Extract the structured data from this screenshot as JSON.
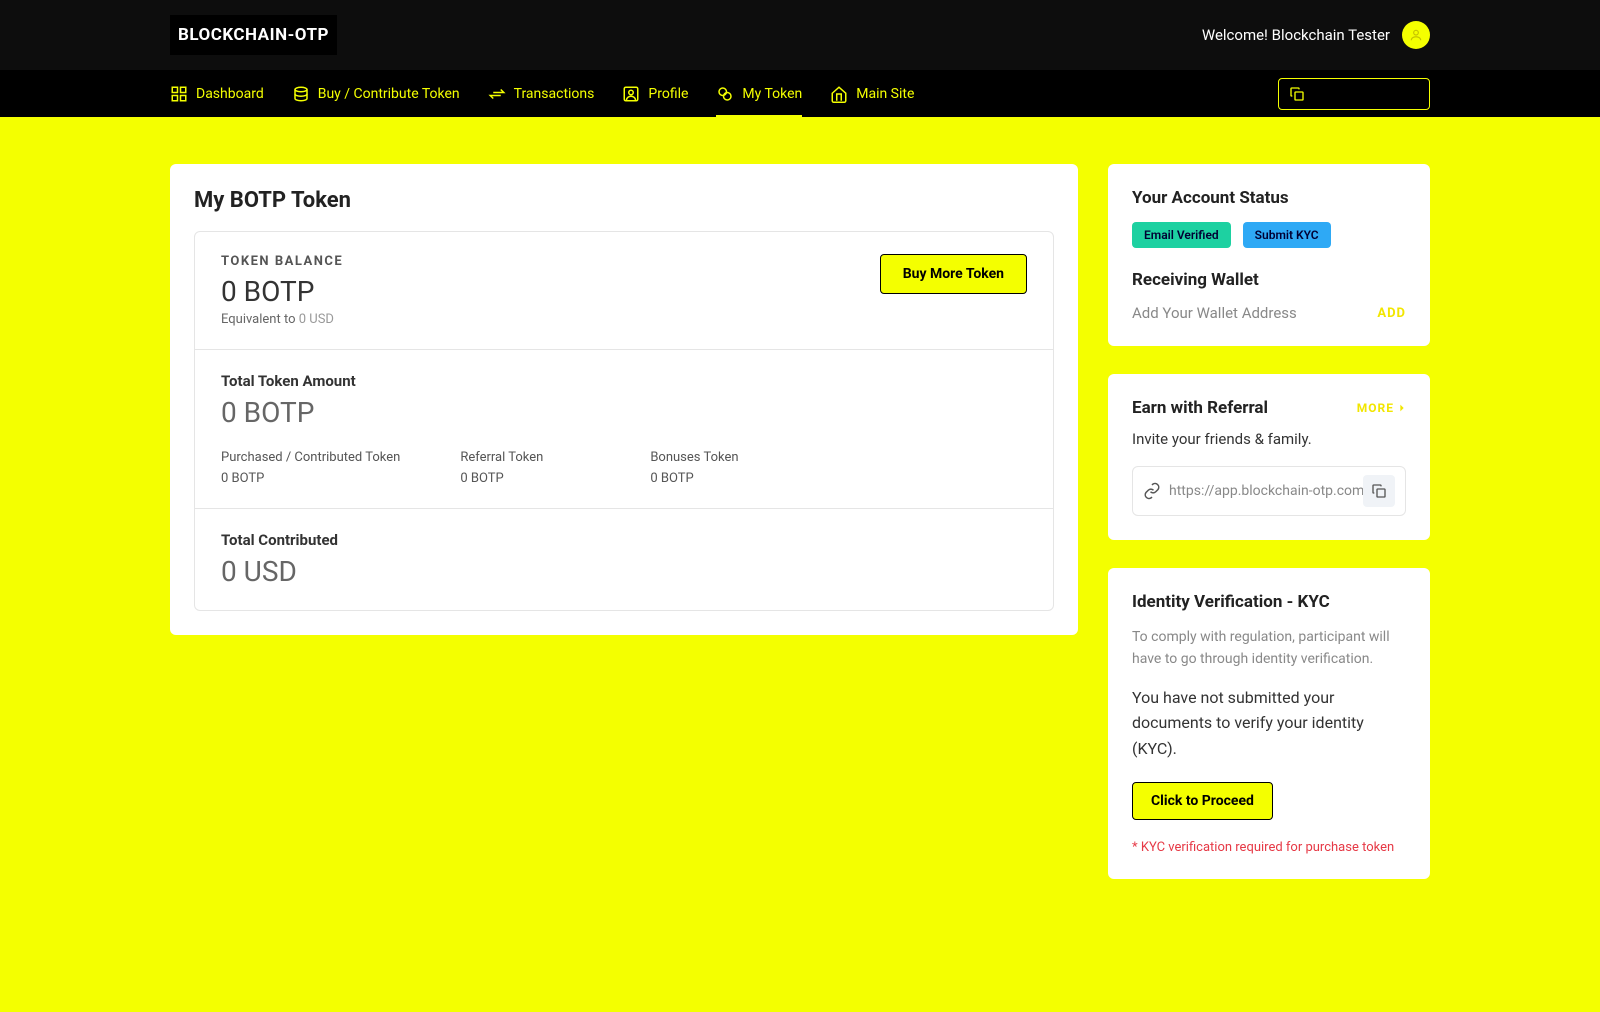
{
  "header": {
    "logo": "BLOCKCHAIN-OTP",
    "welcome": "Welcome! Blockchain Tester"
  },
  "nav": {
    "items": [
      {
        "label": "Dashboard"
      },
      {
        "label": "Buy / Contribute Token"
      },
      {
        "label": "Transactions"
      },
      {
        "label": "Profile"
      },
      {
        "label": "My Token"
      },
      {
        "label": "Main Site"
      }
    ]
  },
  "main": {
    "title": "My BOTP Token",
    "balance": {
      "label": "TOKEN BALANCE",
      "value": "0 BOTP",
      "equiv_prefix": "Equivalent to ",
      "equiv_value": "0 USD",
      "buy_btn": "Buy More Token"
    },
    "total_token": {
      "label": "Total Token Amount",
      "value": "0 BOTP",
      "stats": [
        {
          "label": "Purchased / Contributed Token",
          "value": "0 BOTP"
        },
        {
          "label": "Referral Token",
          "value": "0 BOTP"
        },
        {
          "label": "Bonuses Token",
          "value": "0 BOTP"
        }
      ]
    },
    "contributed": {
      "label": "Total Contributed",
      "value": "0 USD"
    }
  },
  "account_status": {
    "title": "Your Account Status",
    "badge_verified": "Email Verified",
    "badge_kyc": "Submit KYC",
    "wallet_title": "Receiving Wallet",
    "wallet_placeholder": "Add Your Wallet Address",
    "add_label": "ADD"
  },
  "referral": {
    "title": "Earn with Referral",
    "more": "MORE",
    "invite": "Invite your friends & family.",
    "url": "https://app.blockchain-otp.com"
  },
  "kyc": {
    "title": "Identity Verification - KYC",
    "desc": "To comply with regulation, participant will have to go through identity verification.",
    "status": "You have not submitted your documents to verify your identity (KYC).",
    "proceed": "Click to Proceed",
    "warning": "* KYC verification required for purchase token"
  }
}
